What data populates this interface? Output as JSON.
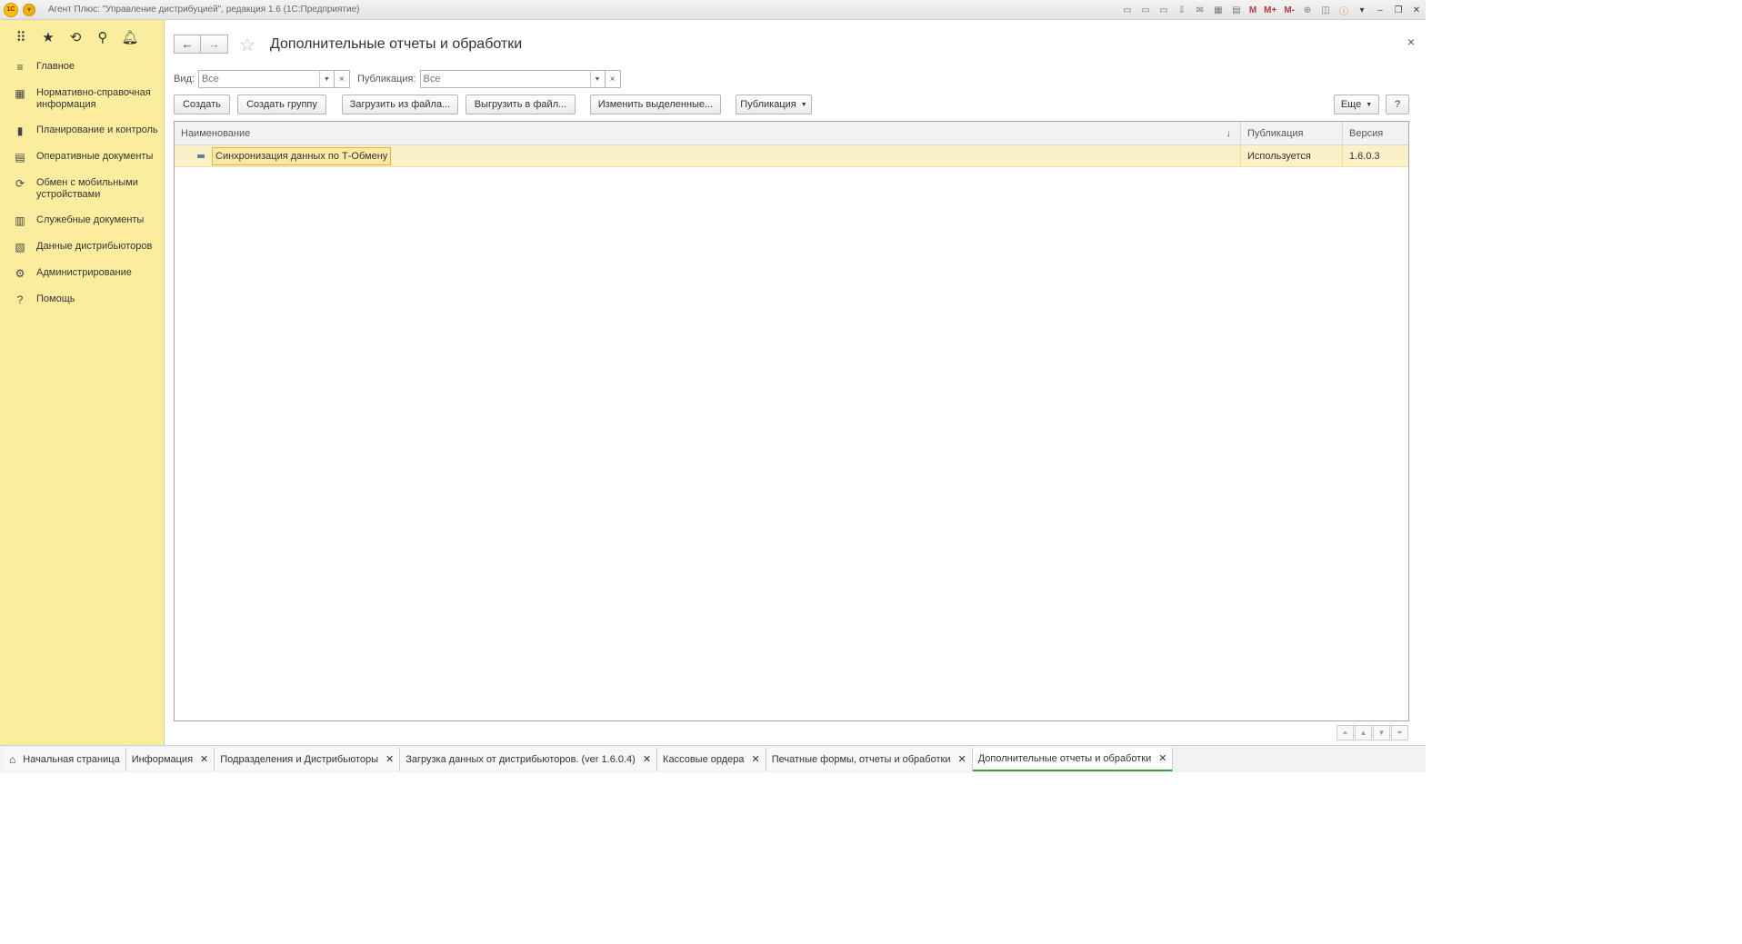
{
  "window": {
    "title": "Агент Плюс: \"Управление дистрибуцией\", редакция 1.6  (1С:Предприятие)",
    "logo": "1С",
    "m_buttons": [
      "M",
      "M+",
      "M-"
    ]
  },
  "sidebar": {
    "top_icons": [
      "apps-grid-icon",
      "star-icon",
      "history-icon",
      "search-icon",
      "bell-icon"
    ],
    "items": [
      {
        "label": "Главное",
        "icon": "≡"
      },
      {
        "label": "Нормативно-справочная информация",
        "icon": "▦"
      },
      {
        "label": "Планирование и контроль",
        "icon": "▮"
      },
      {
        "label": "Оперативные документы",
        "icon": "▤"
      },
      {
        "label": "Обмен с мобильными устройствами",
        "icon": "⟳"
      },
      {
        "label": "Служебные документы",
        "icon": "▥"
      },
      {
        "label": "Данные дистрибьюторов",
        "icon": "▧"
      },
      {
        "label": "Администрирование",
        "icon": "⚙"
      },
      {
        "label": "Помощь",
        "icon": "?"
      }
    ]
  },
  "form": {
    "title": "Дополнительные отчеты и обработки",
    "close": "×",
    "filters": {
      "vid_label": "Вид:",
      "vid_placeholder": "Все",
      "pub_label": "Публикация:",
      "pub_placeholder": "Все",
      "clear": "×"
    },
    "toolbar": {
      "create": "Создать",
      "create_group": "Создать группу",
      "load_file": "Загрузить из файла...",
      "unload_file": "Выгрузить в файл...",
      "change_selected": "Изменить выделенные...",
      "publication": "Публикация",
      "more": "Еще",
      "help": "?"
    },
    "table": {
      "columns": [
        "Наименование",
        "Публикация",
        "Версия"
      ],
      "sort_indicator": "↓",
      "rows": [
        {
          "name": "Синхронизация данных по Т-Обмену",
          "publication": "Используется",
          "version": "1.6.0.3"
        }
      ]
    }
  },
  "tabs": [
    {
      "label": "Начальная страница",
      "closable": false
    },
    {
      "label": "Информация",
      "closable": true
    },
    {
      "label": "Подразделения и Дистрибьюторы",
      "closable": true
    },
    {
      "label": "Загрузка данных от дистрибьюторов. (ver 1.6.0.4)",
      "closable": true
    },
    {
      "label": "Кассовые ордера",
      "closable": true
    },
    {
      "label": "Печатные формы, отчеты и обработки",
      "closable": true
    },
    {
      "label": "Дополнительные отчеты и обработки",
      "closable": true,
      "active": true
    }
  ],
  "colors": {
    "sidebar_bg": "#fbed9e",
    "selected_row": "#fbf0c8",
    "active_tab_underline": "#3b9f3b"
  }
}
